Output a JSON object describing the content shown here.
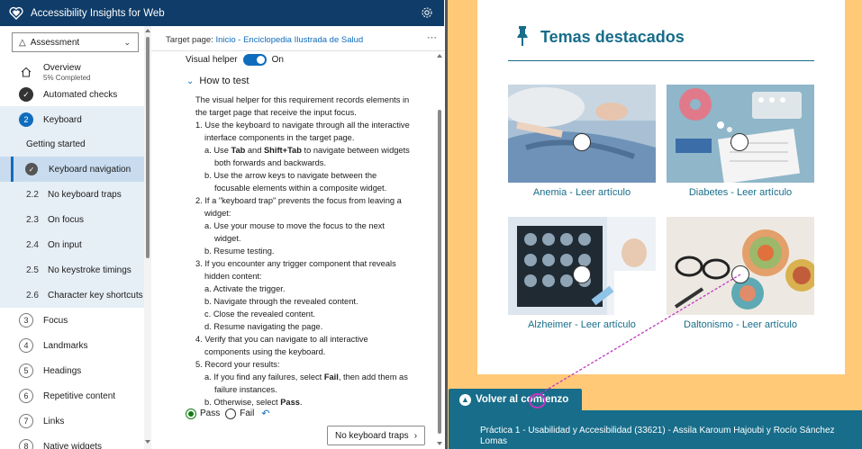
{
  "app": {
    "title": "Accessibility Insights for Web"
  },
  "nav": {
    "mode_select": "Assessment",
    "overview_label": "Overview",
    "overview_sub": "5% Completed",
    "automated_label": "Automated checks",
    "keyboard_num": "2",
    "keyboard_label": "Keyboard",
    "getting_started": "Getting started",
    "selected_label": "Keyboard navigation",
    "subitems": [
      {
        "num": "2.2",
        "label": "No keyboard traps"
      },
      {
        "num": "2.3",
        "label": "On focus"
      },
      {
        "num": "2.4",
        "label": "On input"
      },
      {
        "num": "2.5",
        "label": "No keystroke timings"
      },
      {
        "num": "2.6",
        "label": "Character key shortcuts"
      }
    ],
    "sections": [
      {
        "num": "3",
        "label": "Focus"
      },
      {
        "num": "4",
        "label": "Landmarks"
      },
      {
        "num": "5",
        "label": "Headings"
      },
      {
        "num": "6",
        "label": "Repetitive content"
      },
      {
        "num": "7",
        "label": "Links"
      },
      {
        "num": "8",
        "label": "Native widgets"
      }
    ]
  },
  "content": {
    "target_prefix": "Target page: ",
    "target_link": "Inicio - Enciclopedia Ilustrada de Salud",
    "visual_helper_label": "Visual helper",
    "visual_helper_state": "On",
    "howto_title": "How to test",
    "intro_1": "The visual helper for this requirement records elements in",
    "intro_2": "the target page that receive the input focus.",
    "s1_1": "1. Use the keyboard to navigate through all the interactive",
    "s1_2": "interface components in the target page.",
    "s1a_pre": "a. Use ",
    "s1a_k1": "Tab",
    "s1a_mid": " and ",
    "s1a_k2": "Shift+Tab",
    "s1a_post": " to navigate between widgets",
    "s1a_2": "both forwards and backwards.",
    "s1b_1": "b. Use the arrow keys to navigate between the",
    "s1b_2": "focusable elements within a composite widget.",
    "s2_1": "2. If a \"keyboard trap\" prevents the focus from leaving a",
    "s2_2": "widget:",
    "s2a_1": "a. Use your mouse to move the focus to the next",
    "s2a_2": "widget.",
    "s2b": "b. Resume testing.",
    "s3_1": "3. If you encounter any trigger component that reveals",
    "s3_2": "hidden content:",
    "s3a": "a. Activate the trigger.",
    "s3b": "b. Navigate through the revealed content.",
    "s3c": "c. Close the revealed content.",
    "s3d": "d. Resume navigating the page.",
    "s4_1": "4. Verify that you can navigate to all interactive",
    "s4_2": "components using the keyboard.",
    "s5": "5. Record your results:",
    "s5a_pre": "a. If you find any failures, select ",
    "s5a_k": "Fail",
    "s5a_post": ", then add them as",
    "s5a_2": "failure instances.",
    "s5b_pre": "b. Otherwise, select ",
    "s5b_k": "Pass",
    "s5b_post": ".",
    "pass_label": "Pass",
    "fail_label": "Fail",
    "next_button": "No keyboard traps"
  },
  "web": {
    "section_title": "Temas destacados",
    "articles": [
      {
        "caption": "Anemia - Leer artículo"
      },
      {
        "caption": "Diabetes - Leer artículo"
      },
      {
        "caption": "Alzheimer - Leer artículo"
      },
      {
        "caption": "Daltonismo - Leer artículo"
      }
    ],
    "back_to_top": "Volver al comienzo",
    "footer_1": "Práctica 1 - Usabilidad y Accesibilidad (33621) - Assila Karoum Hajoubi y Rocío Sánchez",
    "footer_2": "Lomas"
  },
  "colors": {
    "titlebar": "#0f3c68",
    "accent": "#0f6cbd",
    "web_teal": "#176d8a",
    "web_bg": "#ffc978",
    "focus_line": "#c038c0"
  },
  "icons": [
    "heart-logo-icon",
    "gear-icon",
    "flask-icon",
    "chevron-down-icon",
    "home-icon",
    "check-icon",
    "undo-icon",
    "pin-icon",
    "arrow-up-icon"
  ]
}
